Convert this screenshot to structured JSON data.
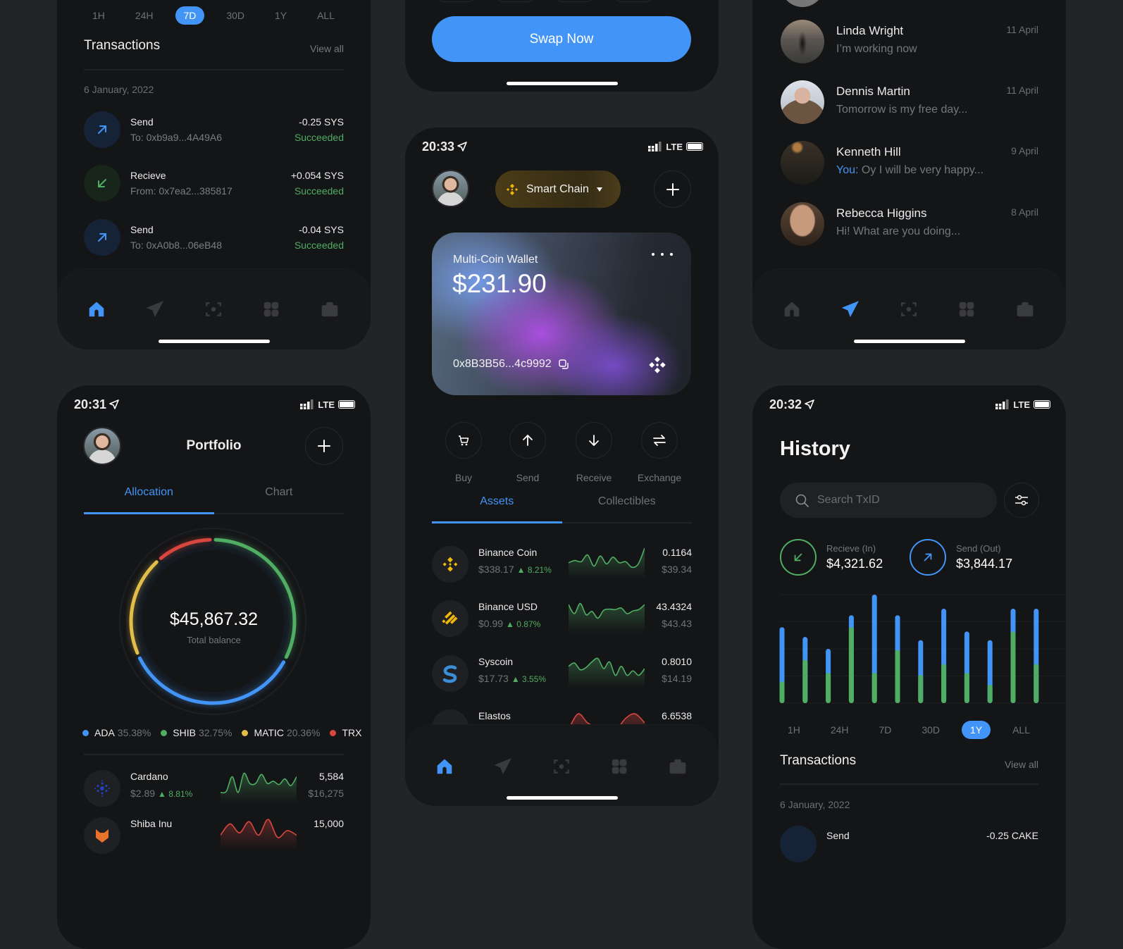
{
  "colors": {
    "background": "#232427",
    "phone": "#141517",
    "accent": "#4294f7",
    "green": "#4fae63",
    "red": "#d9463f",
    "yellow": "#e1bd4a",
    "binance": "#f0b90b"
  },
  "transactions_screen": {
    "periods": [
      "1H",
      "24H",
      "7D",
      "30D",
      "1Y",
      "ALL"
    ],
    "active_period": "7D",
    "title": "Transactions",
    "view_all": "View all",
    "date": "6 January, 2022",
    "items": [
      {
        "type": "send",
        "title": "Send",
        "address": "To: 0xb9a9...4A49A6",
        "amount": "-0.25 SYS",
        "status": "Succeeded"
      },
      {
        "type": "receive",
        "title": "Recieve",
        "address": "From: 0x7ea2...385817",
        "amount": "+0.054 SYS",
        "status": "Succeeded"
      },
      {
        "type": "send",
        "title": "Send",
        "address": "To: 0xA0b8...06eB48",
        "amount": "-0.04 SYS",
        "status": "Succeeded"
      }
    ],
    "nav_active": "home"
  },
  "swap_screen": {
    "button": "Swap Now"
  },
  "wallet_screen": {
    "time": "20:33",
    "network": "LTE",
    "chain_selector": "Smart Chain",
    "card": {
      "title": "Multi-Coin Wallet",
      "balance": "$231.90",
      "address": "0x8B3B56...4c9992"
    },
    "actions": [
      {
        "label": "Buy",
        "icon": "cart-icon"
      },
      {
        "label": "Send",
        "icon": "arrow-up-icon"
      },
      {
        "label": "Receive",
        "icon": "arrow-down-icon"
      },
      {
        "label": "Exchange",
        "icon": "swap-icon"
      }
    ],
    "tabs": [
      "Assets",
      "Collectibles"
    ],
    "active_tab": "Assets",
    "assets": [
      {
        "name": "Binance Coin",
        "price": "$338.17",
        "change": "8.21%",
        "amount": "0.1164",
        "value": "$39.34",
        "trend": "up",
        "spark": [
          0.35,
          0.45,
          0.4,
          0.7,
          0.2,
          0.65,
          0.3,
          0.6,
          0.35,
          0.4,
          0.15,
          0.3,
          1.0
        ]
      },
      {
        "name": "Binance USD",
        "price": "$0.99",
        "change": "0.87%",
        "amount": "43.4324",
        "value": "$43.43",
        "trend": "up",
        "spark": [
          0.9,
          0.5,
          0.95,
          0.45,
          0.6,
          0.3,
          0.65,
          0.7,
          0.68,
          0.75,
          0.5,
          0.62,
          0.68,
          0.9
        ]
      },
      {
        "name": "Syscoin",
        "price": "$17.73",
        "change": "3.55%",
        "amount": "0.8010",
        "value": "$14.19",
        "trend": "up",
        "spark": [
          0.6,
          0.75,
          0.45,
          0.55,
          0.8,
          0.95,
          0.5,
          0.8,
          0.2,
          0.6,
          0.2,
          0.4,
          0.2,
          0.5
        ]
      },
      {
        "name": "Elastos",
        "amount": "6.6538",
        "trend": "down",
        "spark": [
          0.2,
          0.9,
          0.5,
          0.3,
          0.25,
          0.2,
          0.7,
          0.9,
          0.5
        ]
      }
    ],
    "nav_active": "home"
  },
  "messages_screen": {
    "items": [
      {
        "name": "Linda Wright",
        "preview": "I’m working now",
        "date": "11 April"
      },
      {
        "name": "Dennis Martin",
        "preview": "Tomorrow is my free day...",
        "date": "11 April"
      },
      {
        "name": "Kenneth Hill",
        "prefix": "You:",
        "preview": " Oy I will be very happy...",
        "date": "9 April"
      },
      {
        "name": "Rebecca Higgins",
        "preview": "Hi! What are you doing...",
        "date": "8 April"
      }
    ],
    "nav_active": "send"
  },
  "portfolio_screen": {
    "time": "20:31",
    "network": "LTE",
    "title": "Portfolio",
    "tabs": [
      "Allocation",
      "Chart"
    ],
    "active_tab": "Allocation",
    "total": "$45,867.32",
    "total_label": "Total balance",
    "allocation": [
      {
        "symbol": "ADA",
        "percent": "35.38%",
        "value": 35.38,
        "color": "#4294f7"
      },
      {
        "symbol": "SHIB",
        "percent": "32.75%",
        "value": 32.75,
        "color": "#4fae63"
      },
      {
        "symbol": "MATIC",
        "percent": "20.36%",
        "value": 20.36,
        "color": "#e1bd4a"
      },
      {
        "symbol": "TRX",
        "color": "#d9463f"
      }
    ],
    "assets": [
      {
        "name": "Cardano",
        "price": "$2.89",
        "change": "8.81%",
        "amount": "5,584",
        "value": "$16,275",
        "trend": "up",
        "spark": [
          0.1,
          0.15,
          0.8,
          0.1,
          0.95,
          0.5,
          0.5,
          0.9,
          0.5,
          0.6,
          0.45,
          0.7,
          0.4,
          0.8
        ]
      },
      {
        "name": "Shiba Inu",
        "amount": "15,000",
        "trend": "down",
        "spark": [
          0.3,
          0.8,
          0.4,
          0.9,
          0.3,
          1.0,
          0.2,
          0.5,
          0.3
        ]
      }
    ]
  },
  "history_screen": {
    "time": "20:32",
    "network": "LTE",
    "title": "History",
    "search_placeholder": "Search TxID",
    "receive": {
      "label": "Recieve (In)",
      "amount": "$4,321.62"
    },
    "send": {
      "label": "Send (Out)",
      "amount": "$3,844.17"
    },
    "periods": [
      "1H",
      "24H",
      "7D",
      "30D",
      "1Y",
      "ALL"
    ],
    "active_period": "1Y",
    "transactions_title": "Transactions",
    "view_all": "View all",
    "date": "6 January, 2022",
    "first_tx": {
      "title": "Send",
      "amount": "-0.25 CAKE"
    }
  },
  "chart_data": {
    "type": "bar",
    "stacked": true,
    "grid": true,
    "ylim": [
      0,
      100
    ],
    "categories": [
      "1",
      "2",
      "3",
      "4",
      "5",
      "6",
      "7",
      "8",
      "9",
      "10",
      "11",
      "12"
    ],
    "series": [
      {
        "color": "#4fae63",
        "values": [
          20,
          40,
          28,
          70,
          28,
          49,
          26,
          36,
          28,
          17,
          66,
          36
        ]
      },
      {
        "color": "#4294f7",
        "values": [
          50,
          21,
          22,
          11,
          72,
          32,
          32,
          51,
          38,
          41,
          21,
          51
        ]
      }
    ]
  }
}
